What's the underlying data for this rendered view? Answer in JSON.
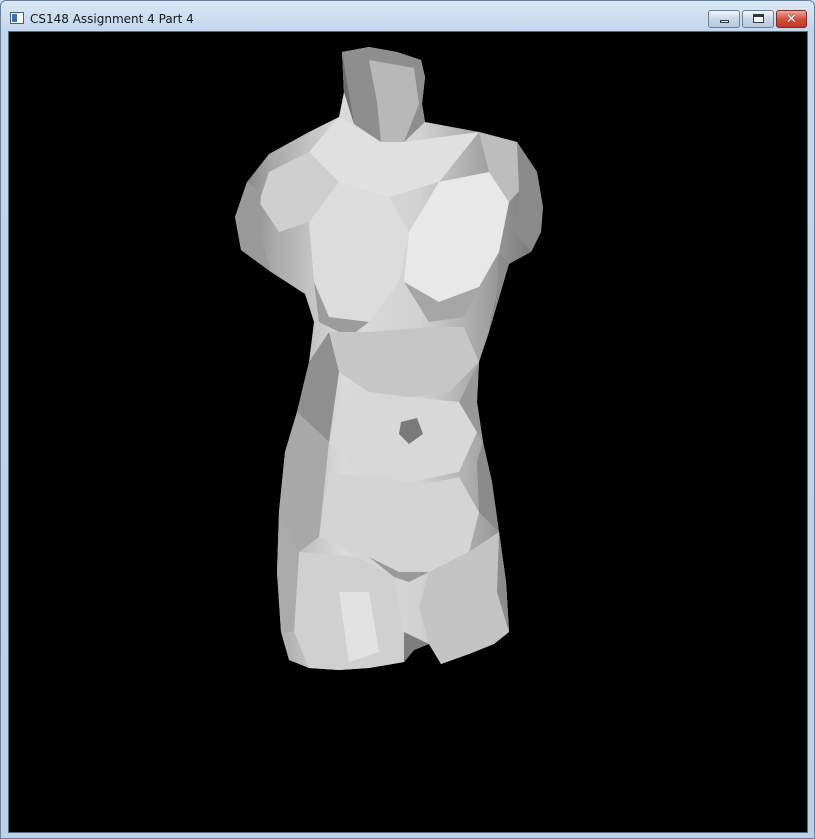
{
  "window": {
    "title": "CS148 Assignment 4 Part 4",
    "title_icon": "app-window-icon",
    "buttons": {
      "minimize": "minimize-icon",
      "maximize": "maximize-icon",
      "close": "close-icon",
      "close_glyph": "✕"
    },
    "close_color": "#c8402c"
  },
  "viewport": {
    "background": "#000000",
    "model_color": "#d6d6d6"
  }
}
